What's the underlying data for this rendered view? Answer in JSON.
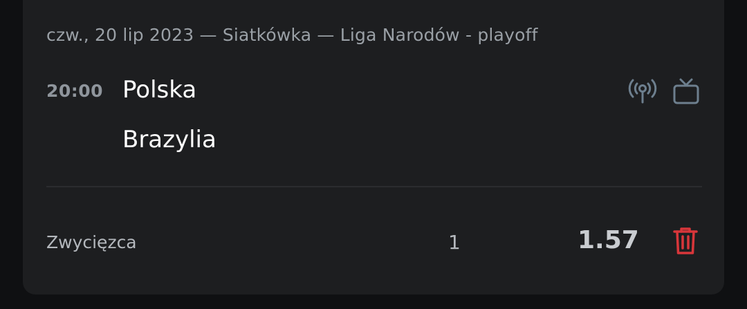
{
  "bet": {
    "meta": "czw., 20 lip 2023 — Siatkówka — Liga Narodów - playoff",
    "time": "20:00",
    "home_team": "Polska",
    "away_team": "Brazylia",
    "market": "Zwycięzca",
    "selection": "1",
    "odds": "1.57"
  },
  "icons": {
    "live": "broadcast-icon",
    "tv": "tv-icon",
    "delete": "trash-icon"
  },
  "colors": {
    "background": "#0f1012",
    "card": "#1d1e20",
    "icon_muted": "#6d7f8e",
    "delete": "#d8363a"
  }
}
